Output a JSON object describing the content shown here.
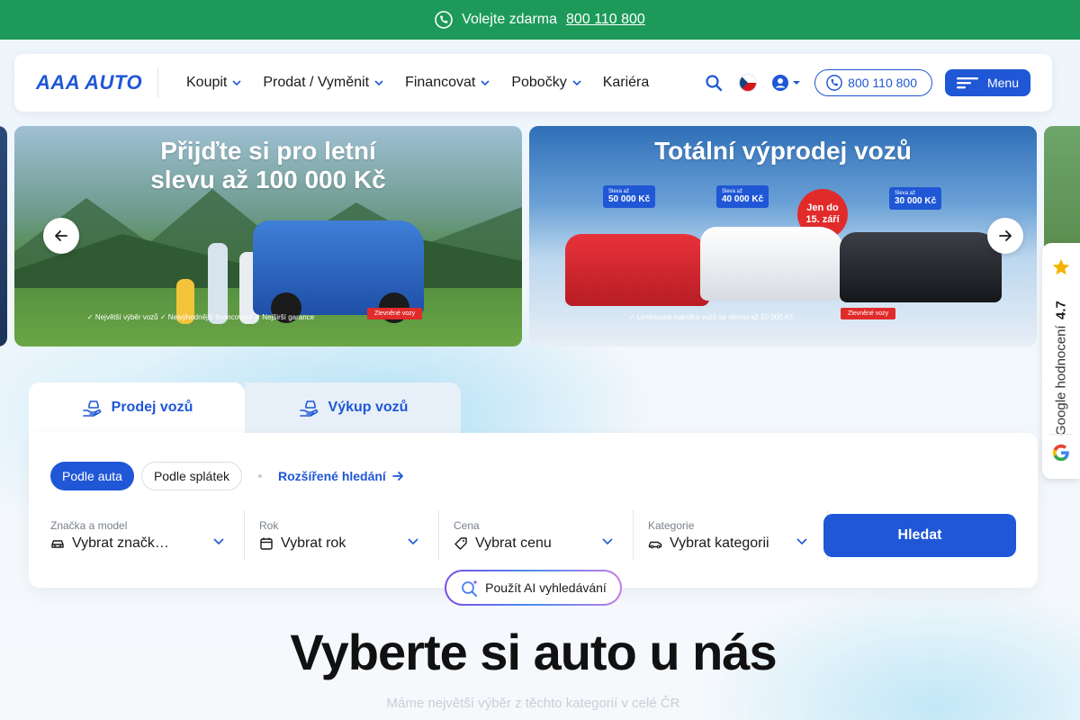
{
  "topbar": {
    "text": "Volejte zdarma",
    "phone": "800 110 800"
  },
  "header": {
    "logo": "AAA AUTO",
    "nav": [
      {
        "label": "Koupit",
        "has_dropdown": true
      },
      {
        "label": "Prodat / Vyměnit",
        "has_dropdown": true
      },
      {
        "label": "Financovat",
        "has_dropdown": true
      },
      {
        "label": "Pobočky",
        "has_dropdown": true
      },
      {
        "label": "Kariéra",
        "has_dropdown": false
      }
    ],
    "phone_button": "800 110 800",
    "menu_button": "Menu"
  },
  "carousel": {
    "slides": [
      {
        "title_line1": "Přijďte si pro letní",
        "title_line2": "slevu až 100 000 Kč",
        "footer": "✓ Největší výběr vozů   ✓ Nejvýhodnější financování   ✓ Nejširší garance",
        "badge": "Zlevněné vozy"
      },
      {
        "title": "Totální výprodej vozů",
        "price_tags": [
          {
            "small": "Sleva až",
            "value": "50 000 Kč"
          },
          {
            "small": "Sleva až",
            "value": "40 000 Kč"
          },
          {
            "small": "Sleva až",
            "value": "30 000 Kč"
          }
        ],
        "deadline_line1": "Jen do",
        "deadline_line2": "15. září",
        "footer": "✓ Limitovaná nabídka vozů se slevou až 50 000 Kč",
        "badge": "Zlevněné vozy"
      }
    ]
  },
  "google_rating": {
    "label": "Google hodnocení",
    "score": "4.7"
  },
  "search": {
    "tabs": [
      "Prodej vozů",
      "Výkup vozů"
    ],
    "filters": [
      "Podle auta",
      "Podle splátek"
    ],
    "advanced_link": "Rozšířené hledání",
    "fields": [
      {
        "label": "Značka a model",
        "value": "Vybrat značk…",
        "icon": "car-icon"
      },
      {
        "label": "Rok",
        "value": "Vybrat rok",
        "icon": "calendar-icon"
      },
      {
        "label": "Cena",
        "value": "Vybrat cenu",
        "icon": "tag-icon"
      },
      {
        "label": "Kategorie",
        "value": "Vybrat kategorii",
        "icon": "car-body-icon"
      }
    ],
    "search_button": "Hledat",
    "ai_button": "Použít AI vyhledávání"
  },
  "section": {
    "title": "Vyberte si auto u nás",
    "subtitle": "Máme největší výběr z těchto kategorií v celé ČR"
  },
  "colors": {
    "brand_blue": "#1f57d6",
    "topbar_green": "#1d9a5a",
    "promo_red": "#e12b2b"
  }
}
